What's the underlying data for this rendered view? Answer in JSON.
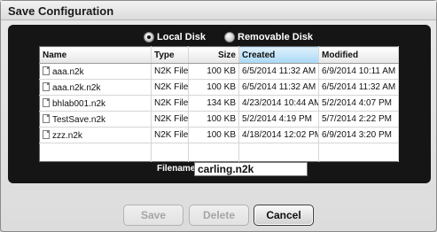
{
  "window": {
    "title": "Save Configuration"
  },
  "storage": {
    "options": [
      {
        "label": "Local Disk",
        "selected": true
      },
      {
        "label": "Removable Disk",
        "selected": false
      }
    ]
  },
  "table": {
    "columns": [
      "Name",
      "Type",
      "Size",
      "Created",
      "Modified"
    ],
    "sorted_column": "Created",
    "rows": [
      {
        "name": "aaa.n2k",
        "type": "N2K File",
        "size": "100 KB",
        "created": "6/5/2014 11:32 AM",
        "modified": "6/9/2014 10:11 AM"
      },
      {
        "name": "aaa.n2k.n2k",
        "type": "N2K File",
        "size": "100 KB",
        "created": "6/5/2014 11:32 AM",
        "modified": "6/5/2014 11:32 AM"
      },
      {
        "name": "bhlab001.n2k",
        "type": "N2K File",
        "size": "134 KB",
        "created": "4/23/2014 10:44 AM",
        "modified": "5/2/2014 4:07 PM"
      },
      {
        "name": "TestSave.n2k",
        "type": "N2K File",
        "size": "100 KB",
        "created": "5/2/2014 4:19 PM",
        "modified": "5/7/2014 2:22 PM"
      },
      {
        "name": "zzz.n2k",
        "type": "N2K File",
        "size": "100 KB",
        "created": "4/18/2014 12:02 PM",
        "modified": "6/9/2014 3:20 PM"
      }
    ]
  },
  "filename": {
    "label": "Filename",
    "value": "carling.n2k"
  },
  "buttons": {
    "save": {
      "label": "Save",
      "enabled": false
    },
    "delete": {
      "label": "Delete",
      "enabled": false
    },
    "cancel": {
      "label": "Cancel",
      "enabled": true
    }
  },
  "colors": {
    "panel": "#151515",
    "sorted_header": "#a9d8f5",
    "dialog": "#e3e3e3"
  }
}
